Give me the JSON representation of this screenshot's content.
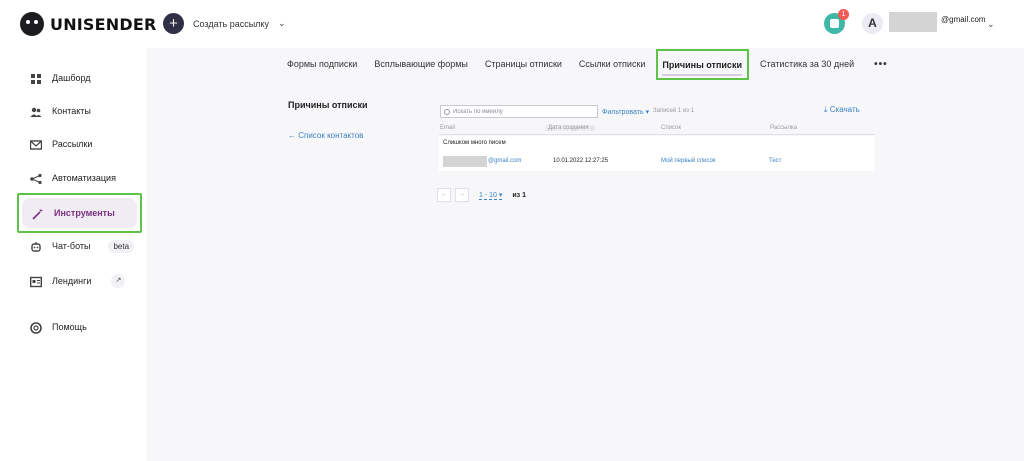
{
  "header": {
    "logo_text": "UNISENDER",
    "create_label": "Создать рассылку",
    "notification_count": "1",
    "avatar_letter": "A",
    "email_domain": "@gmail.com"
  },
  "sidebar": {
    "items": [
      {
        "label": "Дашборд",
        "icon": "dashboard-icon"
      },
      {
        "label": "Контакты",
        "icon": "contacts-icon"
      },
      {
        "label": "Рассылки",
        "icon": "mail-icon"
      },
      {
        "label": "Автоматизация",
        "icon": "automation-icon"
      },
      {
        "label": "Инструменты",
        "icon": "wand-icon"
      },
      {
        "label": "Чат-боты",
        "icon": "bot-icon",
        "badge": "beta"
      },
      {
        "label": "Лендинги",
        "icon": "landing-icon"
      },
      {
        "label": "Помощь",
        "icon": "help-icon"
      }
    ],
    "active_item": "Инструменты"
  },
  "tabs": [
    {
      "label": "Формы подписки"
    },
    {
      "label": "Всплывающие формы"
    },
    {
      "label": "Страницы отписки"
    },
    {
      "label": "Ссылки отписки"
    },
    {
      "label": "Причины отписки"
    },
    {
      "label": "Статистика за 30 дней"
    }
  ],
  "active_tab": "Причины отписки",
  "page": {
    "title": "Причины отписки",
    "back_link": "← Список контактов"
  },
  "toolbar": {
    "search_placeholder": "Искать по имейлу",
    "filter_label": "Фильтровать",
    "records_text": "Записей 1 из 1",
    "download_label": "Скачать"
  },
  "table": {
    "columns": [
      "Email",
      "Дата создания",
      "Список",
      "Рассылка"
    ],
    "reason": "Слишком много писем",
    "rows": [
      {
        "email_domain": "@gmail.com",
        "date": "10.01.2022 12:27:25",
        "list": "Мой первый список",
        "campaign": "Тест"
      }
    ]
  },
  "pagination": {
    "range": "1 - 10",
    "of": "из 1"
  },
  "colors": {
    "accent": "#7a2f80",
    "link": "#3b83c4",
    "highlight": "#5ec447"
  }
}
